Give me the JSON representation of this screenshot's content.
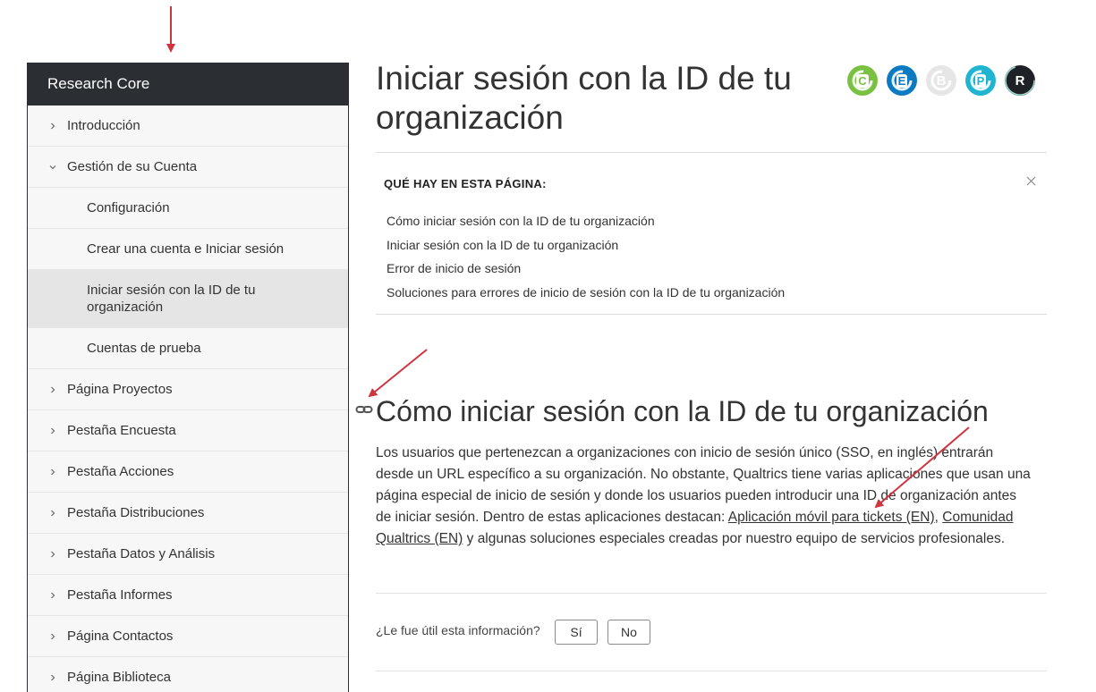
{
  "sidebar": {
    "title": "Research Core",
    "items": [
      {
        "label": "Introducción",
        "level": "top",
        "chevron": "right"
      },
      {
        "label": "Gestión de su Cuenta",
        "level": "top",
        "chevron": "down"
      },
      {
        "label": "Configuración",
        "level": "sub"
      },
      {
        "label": "Crear una cuenta e Iniciar sesión",
        "level": "sub"
      },
      {
        "label": "Iniciar sesión con la ID de tu organización",
        "level": "sub",
        "active": true
      },
      {
        "label": "Cuentas de prueba",
        "level": "sub"
      },
      {
        "label": "Página Proyectos",
        "level": "top",
        "chevron": "right"
      },
      {
        "label": "Pestaña Encuesta",
        "level": "top",
        "chevron": "right"
      },
      {
        "label": "Pestaña Acciones",
        "level": "top",
        "chevron": "right"
      },
      {
        "label": "Pestaña Distribuciones",
        "level": "top",
        "chevron": "right"
      },
      {
        "label": "Pestaña Datos y Análisis",
        "level": "top",
        "chevron": "right"
      },
      {
        "label": "Pestaña Informes",
        "level": "top",
        "chevron": "right"
      },
      {
        "label": "Página Contactos",
        "level": "top",
        "chevron": "right"
      },
      {
        "label": "Página Biblioteca",
        "level": "top",
        "chevron": "right"
      }
    ]
  },
  "page": {
    "title": "Iniciar sesión con la ID de tu organización"
  },
  "badges": [
    {
      "letter": "C",
      "color": "#7ac143",
      "icon": "product-badge-c"
    },
    {
      "letter": "E",
      "color": "#0b7ac1",
      "icon": "product-badge-e"
    },
    {
      "letter": "B",
      "color": "#e6e6e6",
      "icon": "product-badge-b"
    },
    {
      "letter": "P",
      "color": "#1fb4cf",
      "icon": "product-badge-p"
    },
    {
      "letter": "R",
      "color": "#1e2226",
      "icon": "product-badge-r"
    }
  ],
  "toc": {
    "title": "QUÉ HAY EN ESTA PÁGINA:",
    "items": [
      "Cómo iniciar sesión con la ID de tu organización",
      "Iniciar sesión con la ID de tu organización",
      "Error de inicio de sesión",
      "Soluciones para errores de inicio de sesión con la ID de tu organización"
    ]
  },
  "section": {
    "heading": "Cómo iniciar sesión con la ID de tu organización",
    "para_before": "Los usuarios que pertenezcan a organizaciones con inicio de sesión único (SSO, en inglés) entrarán desde un URL específico a su organización. No obstante, Qualtrics tiene varias aplicaciones que usan una página especial de inicio de sesión y donde los usuarios pueden introducir una ID de organización antes de iniciar sesión. Dentro de estas aplicaciones destacan: ",
    "link1": "Aplicación móvil para tickets (EN)",
    "sep": ", ",
    "link2": "Comunidad Qualtrics (EN)",
    "para_after": " y algunas soluciones especiales creadas por nuestro equipo de servicios profesionales."
  },
  "feedback": {
    "question": "¿Le fue útil esta información?",
    "yes": "Sí",
    "no": "No"
  },
  "colors": {
    "sidebar_header": "#2b2f33",
    "annotation_arrow": "#d0343f"
  }
}
